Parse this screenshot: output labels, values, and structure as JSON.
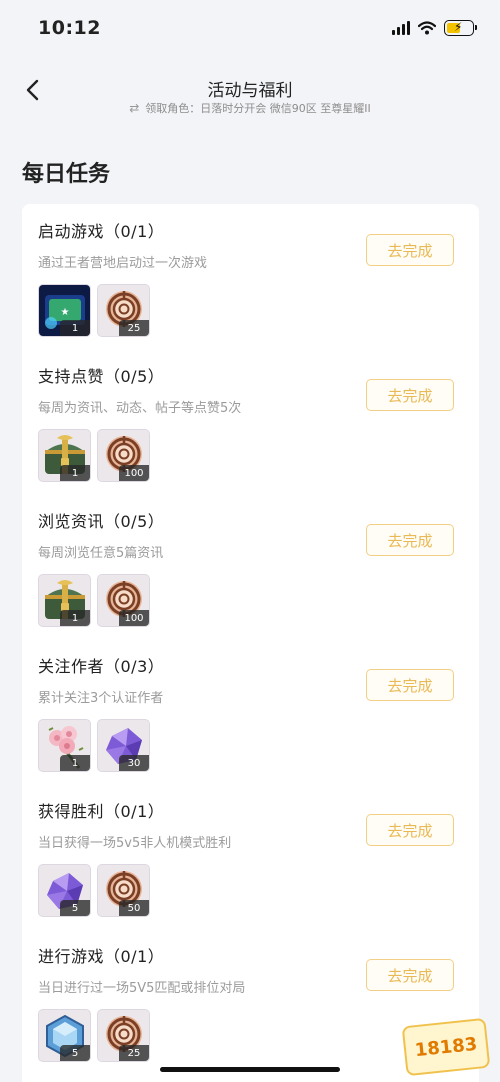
{
  "status_bar": {
    "time": "10:12"
  },
  "header": {
    "title": "活动与福利",
    "subtitle": "领取角色：日落时分开会 微信90区 至尊星耀II"
  },
  "section": {
    "title": "每日任务"
  },
  "tasks": [
    {
      "title": "启动游戏（0/1）",
      "desc": "通过王者营地启动过一次游戏",
      "button": "去完成",
      "rewards": [
        {
          "icon": "emblem-card-icon",
          "count": "1"
        },
        {
          "icon": "bronze-token-icon",
          "count": "25"
        }
      ]
    },
    {
      "title": "支持点赞（0/5）",
      "desc": "每周为资讯、动态、帖子等点赞5次",
      "button": "去完成",
      "rewards": [
        {
          "icon": "treasure-chest-icon",
          "count": "1"
        },
        {
          "icon": "bronze-token-icon",
          "count": "100"
        }
      ]
    },
    {
      "title": "浏览资讯（0/5）",
      "desc": "每周浏览任意5篇资讯",
      "button": "去完成",
      "rewards": [
        {
          "icon": "treasure-chest-icon",
          "count": "1"
        },
        {
          "icon": "bronze-token-icon",
          "count": "100"
        }
      ]
    },
    {
      "title": "关注作者（0/3）",
      "desc": "累计关注3个认证作者",
      "button": "去完成",
      "rewards": [
        {
          "icon": "rose-bouquet-icon",
          "count": "1"
        },
        {
          "icon": "purple-crystal-icon",
          "count": "30"
        }
      ]
    },
    {
      "title": "获得胜利（0/1）",
      "desc": "当日获得一场5v5非人机模式胜利",
      "button": "去完成",
      "rewards": [
        {
          "icon": "purple-crystal-icon",
          "count": "5"
        },
        {
          "icon": "bronze-token-icon",
          "count": "50"
        }
      ]
    },
    {
      "title": "进行游戏（0/1）",
      "desc": "当日进行过一场5V5匹配或排位对局",
      "button": "去完成",
      "rewards": [
        {
          "icon": "blue-crystal-icon",
          "count": "5"
        },
        {
          "icon": "bronze-token-icon",
          "count": "25"
        }
      ]
    }
  ],
  "watermark": "18183",
  "colors": {
    "accent": "#e9b955",
    "accent_border": "#f3cf86",
    "background": "#f3f4f7"
  }
}
